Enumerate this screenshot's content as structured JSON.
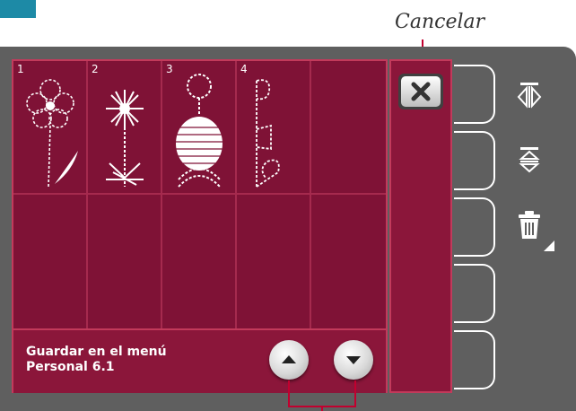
{
  "callout": {
    "cancel_label": "Cancelar"
  },
  "stitches": [
    {
      "number": "1",
      "icon": "flower-stitch-icon"
    },
    {
      "number": "2",
      "icon": "starflower-stitch-icon"
    },
    {
      "number": "3",
      "icon": "bead-stitch-icon"
    },
    {
      "number": "4",
      "icon": "letter-stitch-icon"
    }
  ],
  "save_panel": {
    "line1": "Guardar en el menú",
    "line2": "Personal 6.1"
  },
  "side_tools": [
    {
      "icon": "mirror-side-icon"
    },
    {
      "icon": "mirror-end-icon"
    },
    {
      "icon": "trash-icon"
    }
  ],
  "colors": {
    "panel": "#8b163a",
    "cell": "#7f1236",
    "frame": "#5f5f5f",
    "accent_square": "#1d8aa6",
    "callout_line": "#c2002f"
  }
}
